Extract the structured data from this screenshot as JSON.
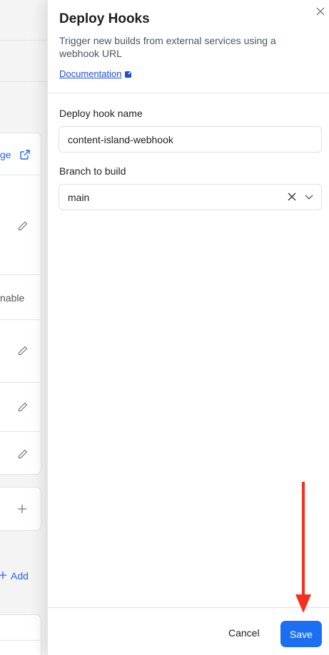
{
  "background": {
    "manage_link_partial": "ge",
    "enable_partial": "nable",
    "add_label": "Add"
  },
  "panel": {
    "title": "Deploy Hooks",
    "description": "Trigger new builds from external services using a webhook URL",
    "doc_link": "Documentation",
    "hook_name": {
      "label": "Deploy hook name",
      "value": "content-island-webhook"
    },
    "branch": {
      "label": "Branch to build",
      "value": "main"
    }
  },
  "footer": {
    "cancel_label": "Cancel",
    "save_label": "Save"
  },
  "colors": {
    "primary": "#1d6ff2",
    "link": "#1d4ed8",
    "annotation_arrow": "#f5301f"
  },
  "icons": [
    "close-icon",
    "external-link-icon",
    "clear-icon",
    "chevron-down-icon",
    "edit-icon",
    "plus-icon"
  ]
}
